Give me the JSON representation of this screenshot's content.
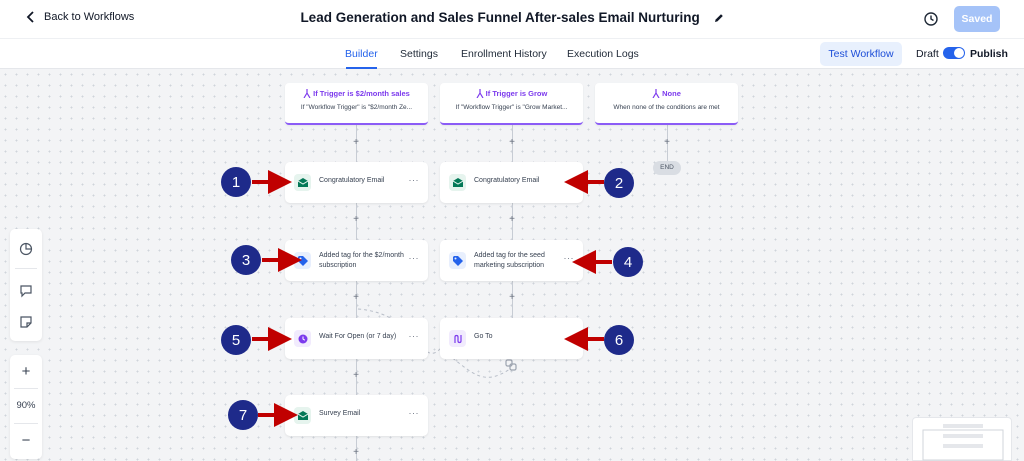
{
  "header": {
    "back_label": "Back to Workflows",
    "title": "Lead Generation and Sales Funnel After-sales Email Nurturing",
    "saved_label": "Saved"
  },
  "tabs": [
    {
      "label": "Builder",
      "active": true
    },
    {
      "label": "Settings",
      "active": false
    },
    {
      "label": "Enrollment History",
      "active": false
    },
    {
      "label": "Execution Logs",
      "active": false
    }
  ],
  "toolbar": {
    "test_label": "Test Workflow",
    "draft_label": "Draft",
    "publish_label": "Publish",
    "publish_on": true
  },
  "branches": [
    {
      "title": "If Trigger is $2/month sales",
      "subtitle": "If \"Workflow Trigger\" is \"$2/month Ze..."
    },
    {
      "title": "If Trigger is Grow",
      "subtitle": "If \"Workflow Trigger\" is \"Grow Market..."
    },
    {
      "title": "None",
      "subtitle": "When none of the conditions are met"
    }
  ],
  "end_label": "END",
  "nodes": [
    {
      "label": "Congratulatory Email",
      "icon": "email-icon",
      "badge": "1"
    },
    {
      "label": "Congratulatory Email",
      "icon": "email-icon",
      "badge": "2"
    },
    {
      "label": "Added tag for the $2/month subscription",
      "icon": "tag-icon",
      "badge": "3"
    },
    {
      "label": "Added tag for the seed marketing subscription",
      "icon": "tag-icon",
      "badge": "4"
    },
    {
      "label": "Wait For Open (or 7 day)",
      "icon": "clock-icon",
      "badge": "5"
    },
    {
      "label": "Go To",
      "icon": "goto-icon",
      "badge": "6"
    },
    {
      "label": "Survey Email",
      "icon": "email-icon",
      "badge": "7"
    }
  ],
  "zoom": {
    "value": "90%",
    "plus": "+",
    "minus": "−"
  },
  "colors": {
    "accent": "#2563eb",
    "branch_purple": "#7c3aed",
    "email_green": "#047857",
    "tag_blue": "#2563eb",
    "badge_navy": "#1e2a8a",
    "arrow_red": "#c00000"
  }
}
